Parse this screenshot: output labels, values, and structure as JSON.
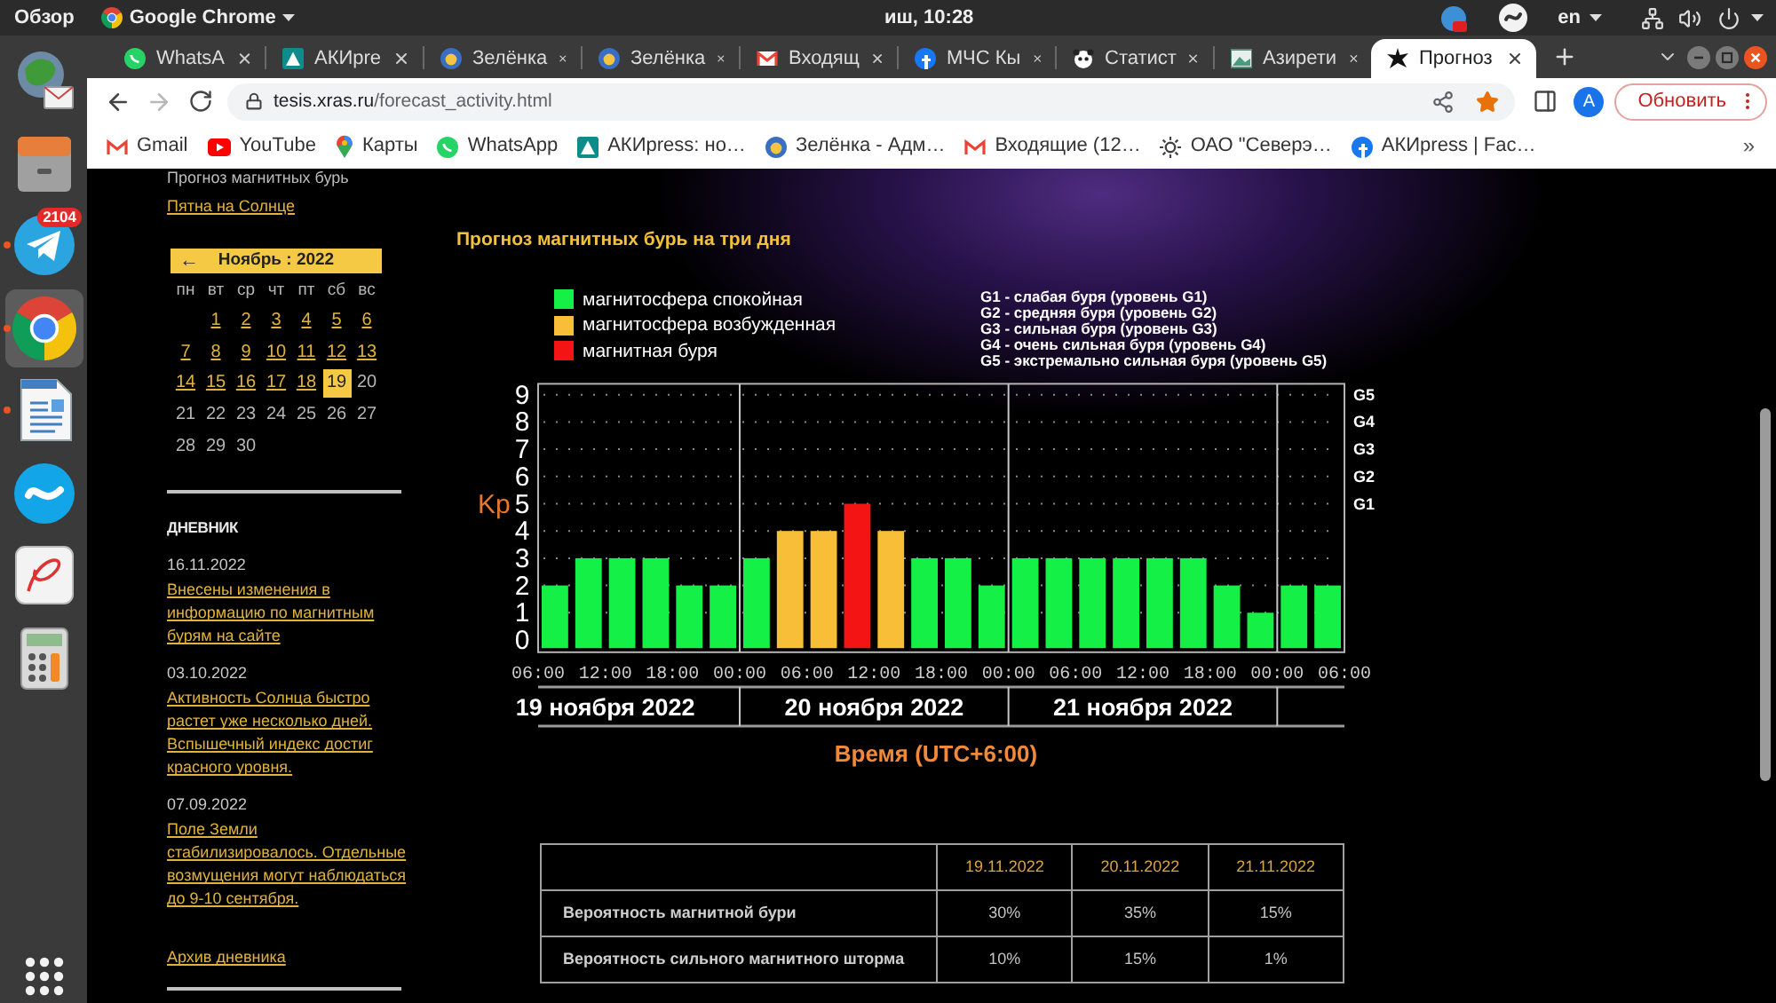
{
  "top_bar": {
    "activities": "Обзор",
    "app_menu": "Google Chrome",
    "clock": "иш, 10:28",
    "keyboard_layout": "en"
  },
  "dock": [
    {
      "running": false,
      "selected": false
    },
    {
      "running": false,
      "selected": false
    },
    {
      "running": true,
      "selected": false,
      "badge": "2104"
    },
    {
      "running": true,
      "selected": true
    },
    {
      "running": true,
      "selected": false
    },
    {
      "running": false,
      "selected": false
    },
    {
      "running": false,
      "selected": false
    },
    {
      "running": false,
      "selected": false
    }
  ],
  "tabs": [
    {
      "title": "WhatsA",
      "selected": false
    },
    {
      "title": "АКИpre",
      "selected": false
    },
    {
      "title": "Зелёнка",
      "selected": false
    },
    {
      "title": "Зелёнка",
      "selected": false
    },
    {
      "title": "Входящ",
      "selected": false
    },
    {
      "title": "МЧС Кы",
      "selected": false
    },
    {
      "title": "Статист",
      "selected": false
    },
    {
      "title": "Азирети",
      "selected": false
    },
    {
      "title": "Прогноз",
      "selected": true
    }
  ],
  "toolbar": {
    "can_go_forward": false,
    "url_host": "tesis.xras.ru",
    "url_path": "/forecast_activity.html",
    "bookmarked": true,
    "profile_initial": "A",
    "update_button": "Обновить"
  },
  "bookmarks": {
    "items": [
      "Gmail",
      "YouTube",
      "Карты",
      "WhatsApp",
      "АКИpress: но…",
      "Зелёнка - Адм…",
      "Входящие (12…",
      "ОАО \"Северэ…",
      "АКИpress | Fac…"
    ],
    "more": "»"
  },
  "sidebar": {
    "current_item": "Прогноз магнитных бурь",
    "sunspots_link": "Пятна на Солнце",
    "calendar": {
      "prev": "←",
      "month": "Ноябрь : 2022",
      "weekdays": [
        "пн",
        "вт",
        "ср",
        "чт",
        "пт",
        "сб",
        "вс"
      ],
      "weeks": [
        {
          "days": [
            {
              "label": "1",
              "link": true,
              "selected": false
            },
            {
              "label": "2",
              "link": true,
              "selected": false
            },
            {
              "label": "3",
              "link": true,
              "selected": false
            },
            {
              "label": "4",
              "link": true,
              "selected": false
            },
            {
              "label": "5",
              "link": true,
              "selected": false
            },
            {
              "label": "6",
              "link": true,
              "selected": false
            }
          ]
        },
        {
          "days": [
            {
              "label": "7",
              "link": true,
              "selected": false
            },
            {
              "label": "8",
              "link": true,
              "selected": false
            },
            {
              "label": "9",
              "link": true,
              "selected": false
            },
            {
              "label": "10",
              "link": true,
              "selected": false
            },
            {
              "label": "11",
              "link": true,
              "selected": false
            },
            {
              "label": "12",
              "link": true,
              "selected": false
            },
            {
              "label": "13",
              "link": true,
              "selected": false
            }
          ]
        },
        {
          "days": [
            {
              "label": "14",
              "link": true,
              "selected": false
            },
            {
              "label": "15",
              "link": true,
              "selected": false
            },
            {
              "label": "16",
              "link": true,
              "selected": false
            },
            {
              "label": "17",
              "link": true,
              "selected": false
            },
            {
              "label": "18",
              "link": true,
              "selected": false
            },
            {
              "label": "19",
              "link": false,
              "selected": true
            },
            {
              "label": "20",
              "link": false,
              "selected": false
            }
          ]
        },
        {
          "days": [
            {
              "label": "21",
              "link": false,
              "selected": false
            },
            {
              "label": "22",
              "link": false,
              "selected": false
            },
            {
              "label": "23",
              "link": false,
              "selected": false
            },
            {
              "label": "24",
              "link": false,
              "selected": false
            },
            {
              "label": "25",
              "link": false,
              "selected": false
            },
            {
              "label": "26",
              "link": false,
              "selected": false
            },
            {
              "label": "27",
              "link": false,
              "selected": false
            }
          ]
        },
        {
          "days": [
            {
              "label": "28",
              "link": false,
              "selected": false
            },
            {
              "label": "29",
              "link": false,
              "selected": false
            },
            {
              "label": "30",
              "link": false,
              "selected": false
            }
          ]
        }
      ]
    },
    "diary": {
      "heading": "ДНЕВНИК",
      "entries": [
        {
          "date": "16.11.2022",
          "text": "Внесены изменения в информацию по магнитным бурям на сайте"
        },
        {
          "date": "03.10.2022",
          "text": "Активность Солнца быстро растет уже несколько дней. Вспышечный индекс достиг красного уровня."
        },
        {
          "date": "07.09.2022",
          "text": "Поле Земли стабилизировалось. Отдельные возмущения могут наблюдаться до 9-10 сентября."
        }
      ],
      "archive_link": "Архив дневника"
    }
  },
  "forecast": {
    "title": "Прогноз магнитных бурь на три дня",
    "g_scale": [
      "G1 - слабая буря (уровень G1)",
      "G2 - средняя буря (уровень G2)",
      "G3 - сильная буря (уровень G3)",
      "G4 - очень сильная буря (уровень G4)",
      "G5 - экстремально сильная буря (уровень G5)"
    ],
    "g_axis": [
      "G5",
      "G4",
      "G3",
      "G2",
      "G1"
    ],
    "time_labels": [
      "06:00",
      "12:00",
      "18:00",
      "00:00",
      "06:00",
      "12:00",
      "18:00",
      "00:00",
      "06:00",
      "12:00",
      "18:00",
      "00:00",
      "06:00"
    ],
    "days": [
      "19 ноября 2022",
      "20 ноября 2022",
      "21 ноября 2022"
    ],
    "chart_data": {
      "type": "bar",
      "xlabel": "Время (UTC+6:00)",
      "ylabel": "Kp",
      "ylim": [
        0,
        9
      ],
      "yticks": [
        0,
        1,
        2,
        3,
        4,
        5,
        6,
        7,
        8,
        9
      ],
      "grid": true,
      "legend": "top-left",
      "series": [
        {
          "name": "магнитосфера спокойная",
          "color": "#14f046",
          "values": [
            2,
            3,
            3,
            3,
            2,
            2,
            3,
            null,
            null,
            null,
            null,
            3,
            3,
            2,
            3,
            3,
            3,
            3,
            3,
            3,
            2,
            1,
            2,
            2
          ]
        },
        {
          "name": "магнитосфера возбужденная",
          "color": "#f8be38",
          "values": [
            null,
            null,
            null,
            null,
            null,
            null,
            null,
            4,
            4,
            null,
            4,
            null,
            null,
            null,
            null,
            null,
            null,
            null,
            null,
            null,
            null,
            null,
            null,
            null
          ]
        },
        {
          "name": "магнитная буря",
          "color": "#f41414",
          "values": [
            null,
            null,
            null,
            null,
            null,
            null,
            null,
            null,
            null,
            5,
            null,
            null,
            null,
            null,
            null,
            null,
            null,
            null,
            null,
            null,
            null,
            null,
            null,
            null
          ]
        }
      ]
    }
  },
  "table": {
    "columns": [
      "19.11.2022",
      "20.11.2022",
      "21.11.2022"
    ],
    "rows": [
      {
        "label": "Вероятность магнитной бури",
        "cells": [
          "30%",
          "35%",
          "15%"
        ]
      },
      {
        "label": "Вероятность сильного магнитного шторма",
        "cells": [
          "10%",
          "15%",
          "1%"
        ]
      }
    ]
  }
}
